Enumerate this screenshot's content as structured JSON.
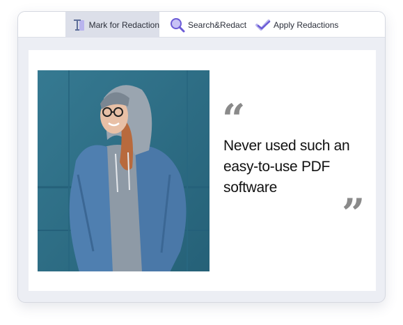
{
  "toolbar": {
    "mark_label": "Mark for Redaction",
    "search_label": "Search&Redact",
    "apply_label": "Apply Redactions"
  },
  "icons": {
    "mark": "text-cursor-icon",
    "search": "magnifier-icon",
    "apply": "double-check-icon"
  },
  "colors": {
    "active_tool_bg": "#dcdfe9",
    "icon_purple": "#6b5bd6",
    "photo_wall": "#2d6e87",
    "quote_marks": "#8a8a8a"
  },
  "document": {
    "quote_open": "“",
    "quote_text": "Never used such an easy-to-use PDF software",
    "quote_close": "”"
  }
}
